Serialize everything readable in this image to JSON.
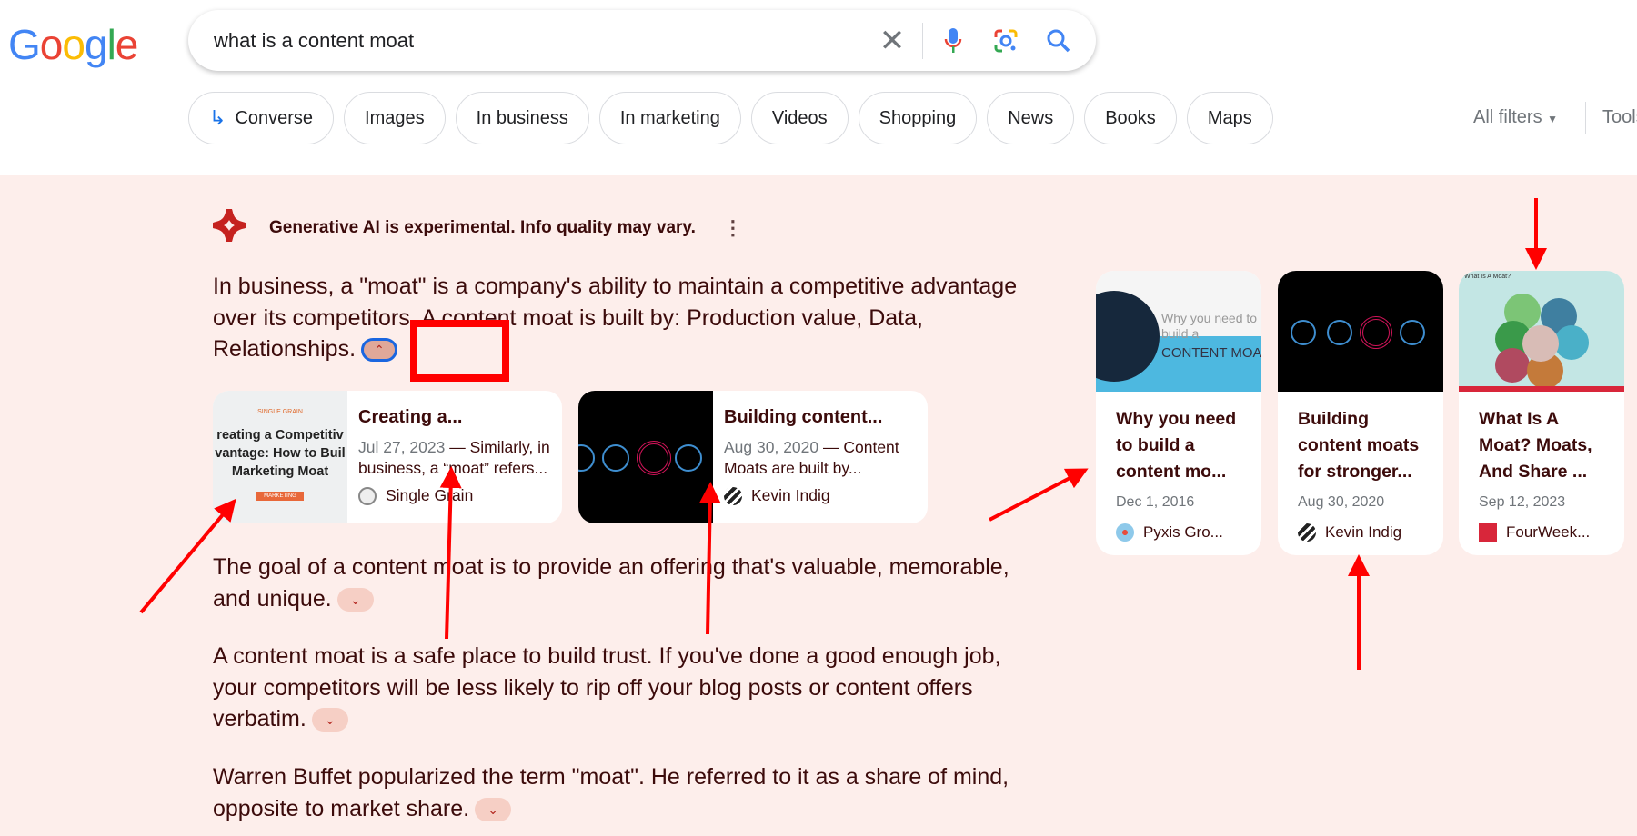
{
  "logo": "Google",
  "search": {
    "query": "what is a content moat",
    "icons": [
      "close-icon",
      "mic-icon",
      "lens-icon",
      "search-icon"
    ]
  },
  "chips": [
    {
      "label": "Converse",
      "icon": "arrow-turn-icon"
    },
    {
      "label": "Images"
    },
    {
      "label": "In business"
    },
    {
      "label": "In marketing"
    },
    {
      "label": "Videos"
    },
    {
      "label": "Shopping"
    },
    {
      "label": "News"
    },
    {
      "label": "Books"
    },
    {
      "label": "Maps"
    }
  ],
  "filters": {
    "all_filters": "All filters",
    "tools": "Tools"
  },
  "ai": {
    "header": "Generative AI is experimental. Info quality may vary.",
    "paragraphs": [
      "In business, a \"moat\" is a company's ability to maintain a competitive advantage over its competitors. A content moat is built by: Production value, Data, Relationships.",
      "The goal of a content moat is to provide an offering that's valuable, memorable, and unique.",
      "A content moat is a safe place to build trust. If you've done a good enough job, your competitors will be less likely to rip off your blog posts or content offers verbatim.",
      "Warren Buffet popularized the term \"moat\". He referred to it as a share of mind, opposite to market share."
    ],
    "inline_cards": [
      {
        "title": "Creating a...",
        "date": "Jul 27, 2023",
        "snippet": "Similarly, in business, a “moat” refers...",
        "source": "Single Grain",
        "thumb_text": "reating a Competitiv vantage: How to Buil Marketing Moat",
        "thumb_tag": "MARKETING",
        "thumb_brand": "SINGLE GRAIN"
      },
      {
        "title": "Building content...",
        "date": "Aug 30, 2020",
        "snippet": "Content Moats are built by...",
        "source": "Kevin Indig"
      }
    ],
    "side_cards": [
      {
        "title": "Why you need to build a content mo...",
        "date": "Dec 1, 2016",
        "source": "Pyxis Gro...",
        "thumb_text": "Why you need to build a",
        "thumb_banner": "CONTENT MOA"
      },
      {
        "title": "Building content moats for stronger...",
        "date": "Aug 30, 2020",
        "source": "Kevin Indig"
      },
      {
        "title": "What Is A Moat? Moats, And Share ...",
        "date": "Sep 12, 2023",
        "source": "FourWeek...",
        "thumb_text": "What Is A Moat?"
      }
    ]
  },
  "colors": {
    "accent": "#1a73e8",
    "ai_bg": "#fdeeeb",
    "text": "#3c0b0b",
    "annotation": "#ff0000"
  }
}
